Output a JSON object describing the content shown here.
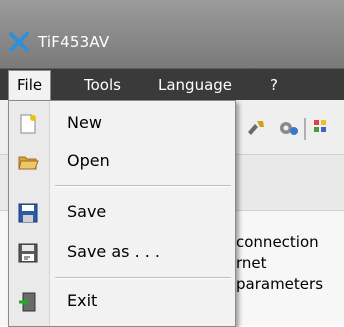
{
  "window": {
    "title": "TiF453AV"
  },
  "menubar": {
    "file": "File",
    "tools": "Tools",
    "language": "Language",
    "help": "?"
  },
  "file_menu": {
    "items": [
      {
        "label": "New",
        "icon": "new-file-icon"
      },
      {
        "label": "Open",
        "icon": "open-folder-icon"
      },
      {
        "label": "Save",
        "icon": "save-icon"
      },
      {
        "label": "Save as . . .",
        "icon": "save-as-icon"
      },
      {
        "label": "Exit",
        "icon": "exit-icon"
      }
    ]
  },
  "background": {
    "line1": "connection",
    "line2": "rnet",
    "line3": "parameters"
  },
  "colors": {
    "titlebar": "#8c8c8c",
    "menubar": "#3a3a3a",
    "menu_bg": "#f2f2f2",
    "app_icon": "#2f8fd8"
  }
}
